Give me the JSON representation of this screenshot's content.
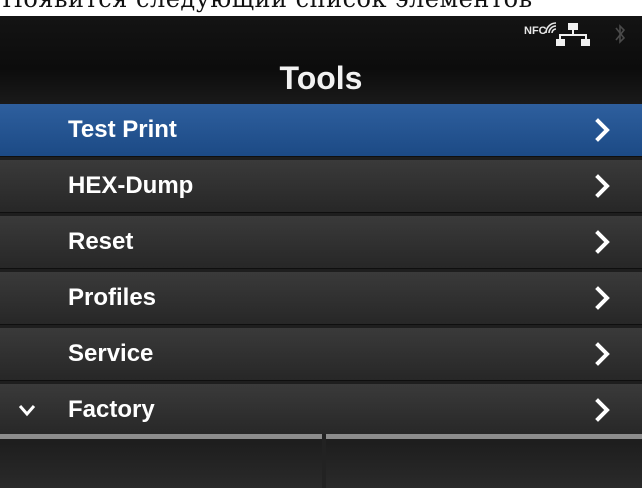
{
  "caption": {
    "text": "Появится следующий список элементов"
  },
  "header": {
    "title": "Tools",
    "status": {
      "nfc_label": "NFC"
    }
  },
  "menu": {
    "items": [
      {
        "label": "Test Print",
        "selected": true
      },
      {
        "label": "HEX-Dump"
      },
      {
        "label": "Reset"
      },
      {
        "label": "Profiles"
      },
      {
        "label": "Service"
      },
      {
        "label": "Factory"
      }
    ]
  },
  "colors": {
    "selected": "#1f4f8c",
    "item_bg": "#2f2f2f",
    "text": "#ffffff"
  },
  "icons": [
    "nfc-icon",
    "lan-icon",
    "bluetooth-icon",
    "chevron-right-icon",
    "chevron-down-icon"
  ]
}
